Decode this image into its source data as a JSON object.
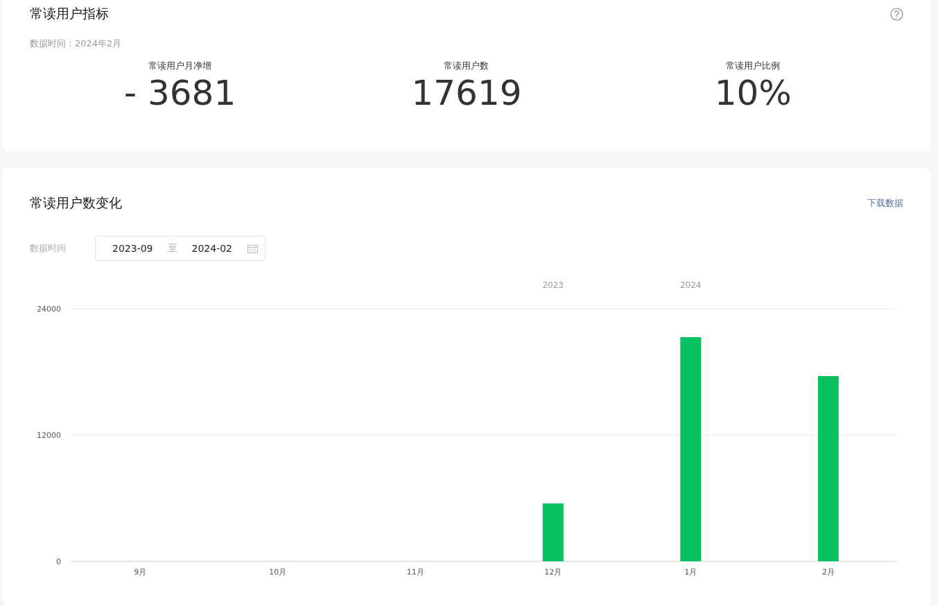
{
  "metrics_card": {
    "title": "常读用户指标",
    "data_time": "数据时间：2024年2月",
    "metrics": [
      {
        "label": "常读用户月净增",
        "value": "- 3681"
      },
      {
        "label": "常读用户数",
        "value": "17619"
      },
      {
        "label": "常读用户比例",
        "value": "10%"
      }
    ]
  },
  "trend_card": {
    "title": "常读用户数变化",
    "download_link": "下载数据",
    "date_label": "数据时间",
    "date_range": {
      "start": "2023-09",
      "separator": "至",
      "end": "2024-02"
    },
    "chart_data": {
      "type": "bar",
      "categories": [
        "9月",
        "10月",
        "11月",
        "12月",
        "1月",
        "2月"
      ],
      "series": [
        {
          "color": "#07c160",
          "values": [
            0,
            0,
            0,
            5500,
            21300,
            17600
          ]
        }
      ],
      "ylim": [
        0,
        24000
      ],
      "yticks": [
        0,
        12000,
        24000
      ]
    },
    "year_labels": [
      "2023",
      "2024"
    ]
  }
}
